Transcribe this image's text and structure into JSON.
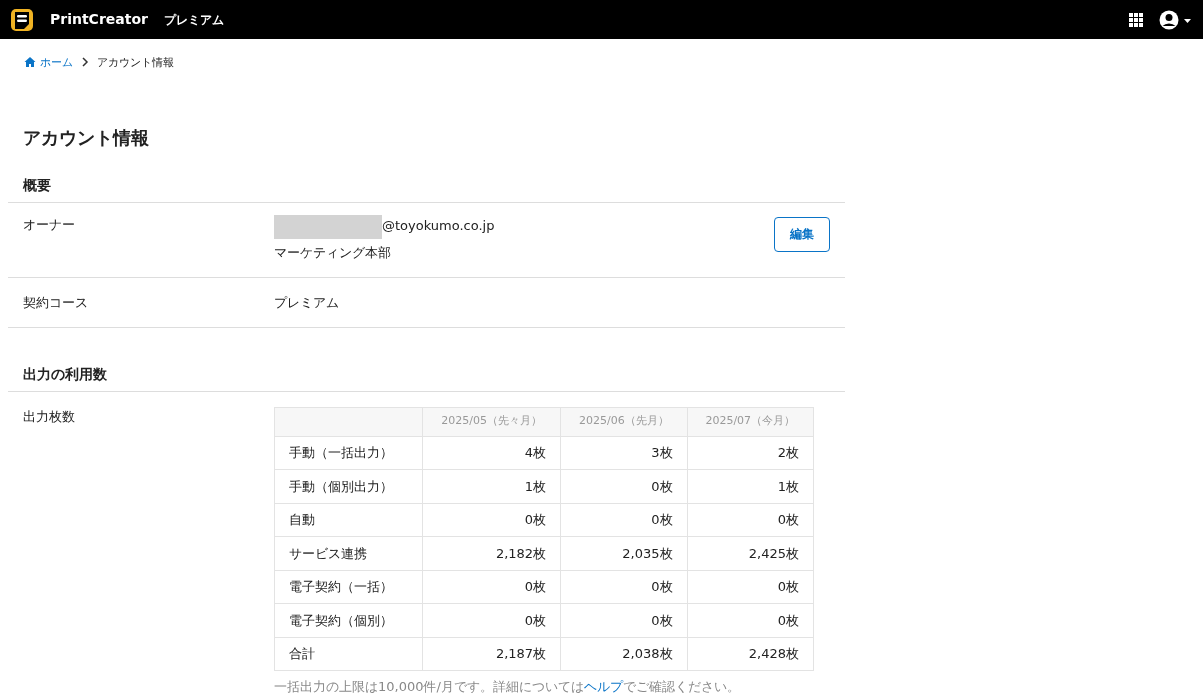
{
  "header": {
    "app_name": "PrintCreator",
    "plan": "プレミアム"
  },
  "breadcrumb": {
    "home": "ホーム",
    "current": "アカウント情報"
  },
  "page_title": "アカウント情報",
  "summary": {
    "heading": "概要",
    "owner": {
      "label": "オーナー",
      "email": "@toyokumo.co.jp",
      "department": "マーケティング本部",
      "edit_button": "編集"
    },
    "course": {
      "label": "契約コース",
      "value": "プレミアム"
    }
  },
  "usage": {
    "heading": "出力の利用数",
    "label": "出力枚数",
    "table": {
      "columns": [
        "2025/05（先々月）",
        "2025/06（先月）",
        "2025/07（今月）"
      ],
      "rows": [
        {
          "label": "手動（一括出力）",
          "values": [
            "4枚",
            "3枚",
            "2枚"
          ]
        },
        {
          "label": "手動（個別出力）",
          "values": [
            "1枚",
            "0枚",
            "1枚"
          ]
        },
        {
          "label": "自動",
          "values": [
            "0枚",
            "0枚",
            "0枚"
          ]
        },
        {
          "label": "サービス連携",
          "values": [
            "2,182枚",
            "2,035枚",
            "2,425枚"
          ]
        },
        {
          "label": "電子契約（一括）",
          "values": [
            "0枚",
            "0枚",
            "0枚"
          ]
        },
        {
          "label": "電子契約（個別）",
          "values": [
            "0枚",
            "0枚",
            "0枚"
          ]
        },
        {
          "label": "合計",
          "values": [
            "2,187枚",
            "2,038枚",
            "2,428枚"
          ]
        }
      ]
    },
    "note": {
      "before": "一括出力の上限は10,000件/月です。詳細については",
      "link": "ヘルプ",
      "after": "でご確認ください。"
    }
  }
}
